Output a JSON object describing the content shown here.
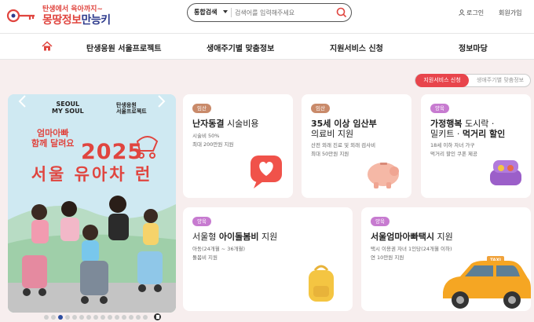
{
  "header": {
    "logo_top": "탄생에서 육아까지~",
    "logo_main_a": "몽땅정보",
    "logo_main_b": "만능키",
    "search": {
      "category": "통합검색",
      "placeholder": "검색어를 입력해주세요"
    },
    "login_label": "로그인",
    "join_label": "회원가입"
  },
  "nav": {
    "items": [
      "탄생응원 서울프로젝트",
      "생애주기별 맞춤정보",
      "지원서비스 신청",
      "정보마당"
    ]
  },
  "toggle": {
    "active": "지원서비스 신청",
    "inactive": "생애주기별 맞춤정보"
  },
  "banner": {
    "logo_left": "SEOUL\nMY SOUL",
    "logo_right": "탄생응원\n서울프로젝트",
    "subtitle": "엄마아빠\n함께 달려요",
    "year": "2025",
    "title": "서울 유아차 런",
    "slide_count": 15,
    "active_slide": 3
  },
  "cards": [
    {
      "tag": "임산",
      "title_bold": "난자동결",
      "title_rest": " 시술비용",
      "lines": [
        "시술비 50%",
        "최대 200만원 지원"
      ]
    },
    {
      "tag": "임산",
      "title_line1_bold": "35세 이상 임산부",
      "title_line2": "의료비 지원",
      "lines": [
        "산전 외래 진료 및 외래 검사비",
        "최대 50만원 지원"
      ]
    },
    {
      "tag": "양육",
      "title_line1_a": "가정행복",
      "title_line1_b": " 도시락 ·",
      "title_line2_a": "밀키트 · ",
      "title_line2_b": "먹거리 할인",
      "lines": [
        "18세 이하 자녀 가구",
        "먹거리 할인 쿠폰 제공"
      ]
    },
    {
      "tag": "양육",
      "title_a": "서울형 ",
      "title_b": "아이돌봄비",
      "title_c": " 지원",
      "lines": [
        "아동(24개월 ~ 36개월)",
        "돌봄비 지원"
      ]
    },
    {
      "tag": "양육",
      "title_b": "서울엄마아빠택시",
      "title_c": " 지원",
      "lines": [
        "택시 이용권 자녀 1인당(24개월 이하)",
        "연 10만원 지원"
      ],
      "taxi_sign": "TAXI"
    }
  ],
  "colors": {
    "accent": "#e8454c",
    "brand_red": "#e0453f",
    "brand_navy": "#2d3a8c",
    "bg": "#f7eeee"
  }
}
